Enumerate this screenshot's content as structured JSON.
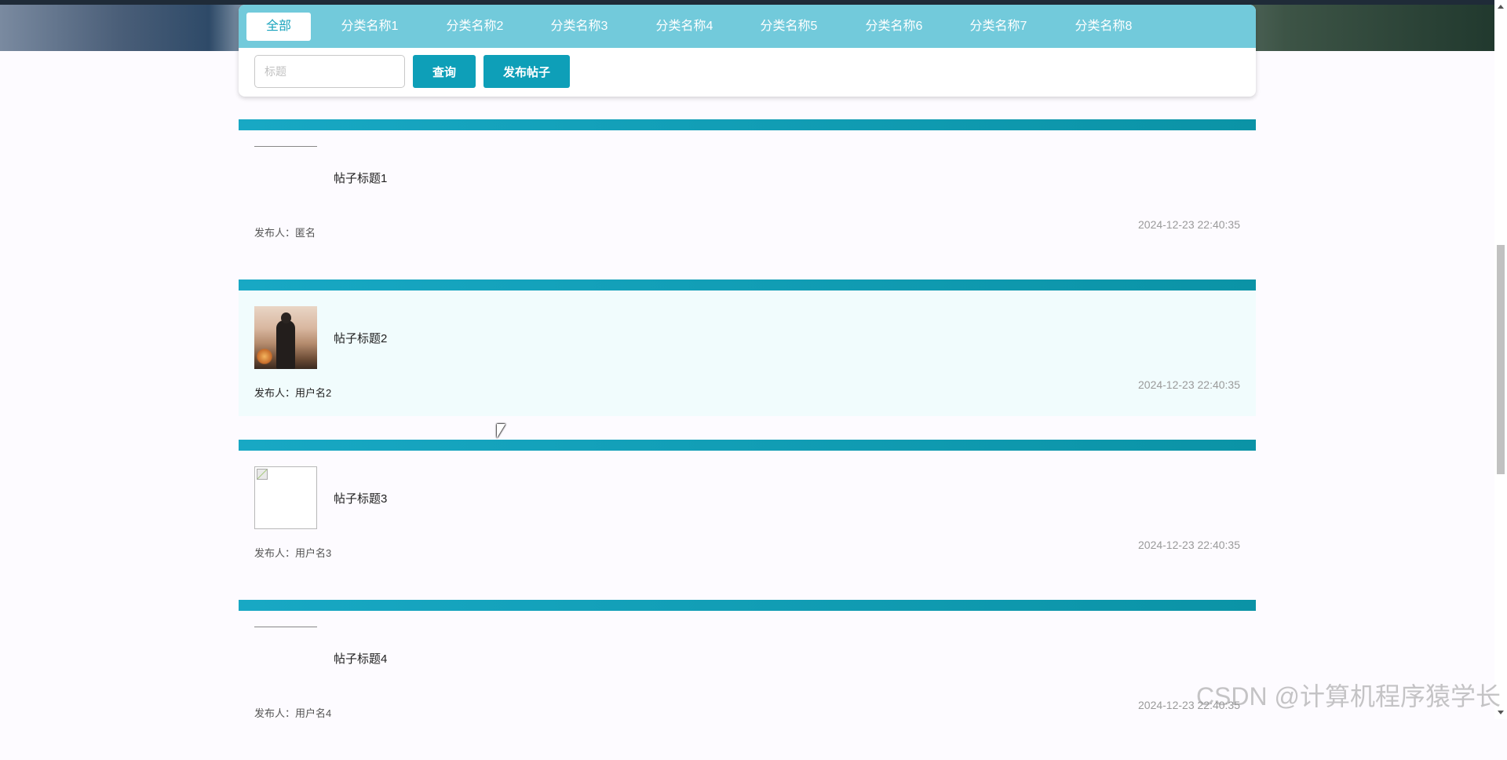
{
  "tabs": [
    {
      "label": "全部",
      "active": true
    },
    {
      "label": "分类名称1",
      "active": false
    },
    {
      "label": "分类名称2",
      "active": false
    },
    {
      "label": "分类名称3",
      "active": false
    },
    {
      "label": "分类名称4",
      "active": false
    },
    {
      "label": "分类名称5",
      "active": false
    },
    {
      "label": "分类名称6",
      "active": false
    },
    {
      "label": "分类名称7",
      "active": false
    },
    {
      "label": "分类名称8",
      "active": false
    }
  ],
  "search": {
    "placeholder": "标题",
    "value": "",
    "query_label": "查询",
    "publish_label": "发布帖子"
  },
  "posts": [
    {
      "title": "帖子标题1",
      "author": "发布人：匿名",
      "time": "2024-12-23 22:40:35",
      "thumbnail": "none"
    },
    {
      "title": "帖子标题2",
      "author": "发布人：用户名2",
      "time": "2024-12-23 22:40:35",
      "thumbnail": "photo"
    },
    {
      "title": "帖子标题3",
      "author": "发布人：用户名3",
      "time": "2024-12-23 22:40:35",
      "thumbnail": "broken-image-icon"
    },
    {
      "title": "帖子标题4",
      "author": "发布人：用户名4",
      "time": "2024-12-23 22:40:35",
      "thumbnail": "none"
    }
  ],
  "watermark": "CSDN @计算机程序猿学长",
  "colors": {
    "tab_bar": "#72cadb",
    "accent": "#0e9fb8",
    "post_bar": "#0b93a6",
    "hover_bg": "#f1fcfd"
  }
}
